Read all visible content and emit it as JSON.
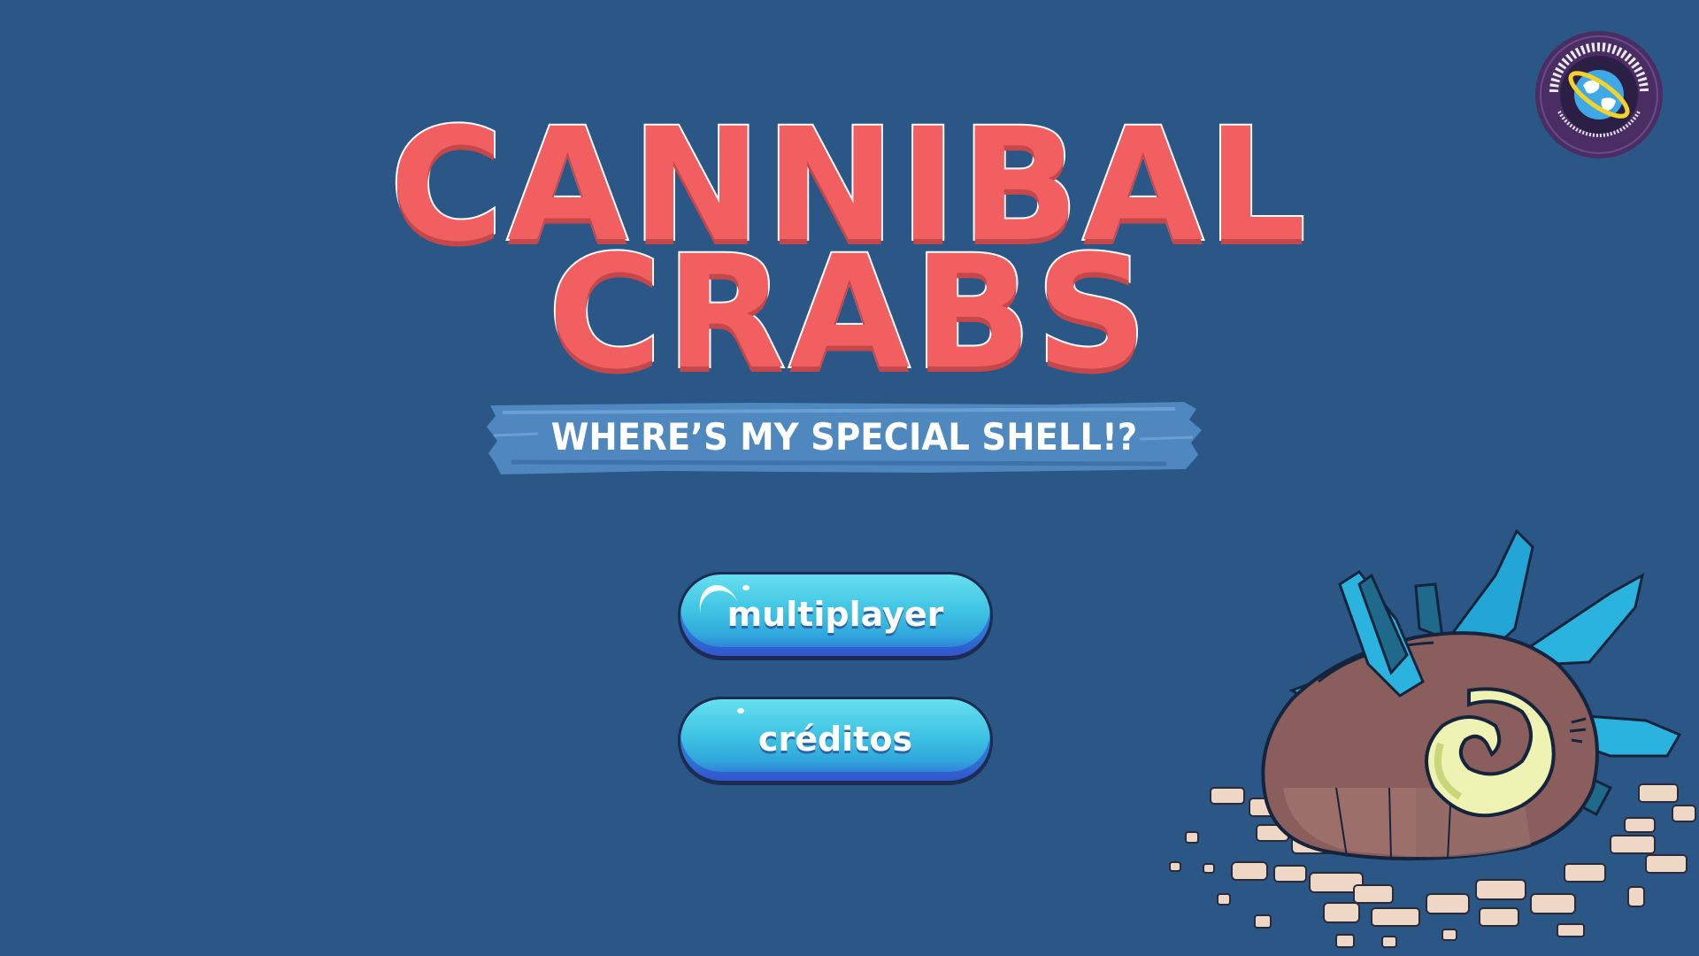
{
  "game": {
    "title_line1": "CANNIBAL",
    "title_line2": "CRABS",
    "subtitle": "WHERE’S MY SPECIAL SHELL!?"
  },
  "menu": {
    "multiplayer_label": "multiplayer",
    "creditos_label": "créditos"
  },
  "logo": {
    "name": "Global Game Jam logo",
    "icon": "globe-icon"
  },
  "colors": {
    "background": "#2b5787",
    "title": "#f25f60",
    "button": "#3fc3e3",
    "banner": "#4f87bf"
  }
}
